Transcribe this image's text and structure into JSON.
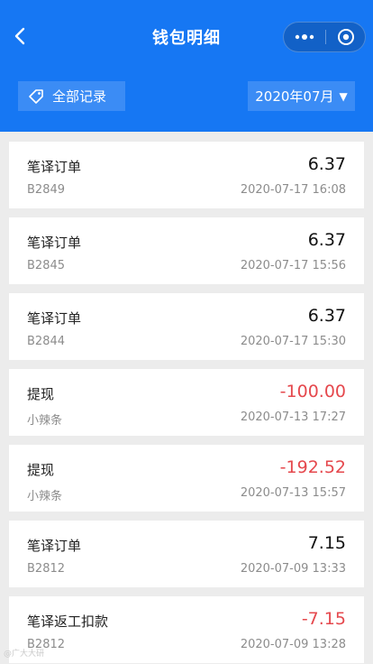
{
  "header": {
    "title": "钱包明细",
    "filter_label": "全部记录",
    "month_label": "2020年07月",
    "month_caret": "▼"
  },
  "colors": {
    "header_bg": "#1677f3",
    "negative": "#e5484d",
    "positive": "#111111"
  },
  "records": [
    {
      "type": "笔译订单",
      "sub": "B2849",
      "amount": "6.37",
      "time": "2020-07-17 16:08",
      "negative": false
    },
    {
      "type": "笔译订单",
      "sub": "B2845",
      "amount": "6.37",
      "time": "2020-07-17 15:56",
      "negative": false
    },
    {
      "type": "笔译订单",
      "sub": "B2844",
      "amount": "6.37",
      "time": "2020-07-17 15:30",
      "negative": false
    },
    {
      "type": "提现",
      "sub": "小辣条",
      "amount": "-100.00",
      "time": "2020-07-13 17:27",
      "negative": true
    },
    {
      "type": "提现",
      "sub": "小辣条",
      "amount": "-192.52",
      "time": "2020-07-13 15:57",
      "negative": true
    },
    {
      "type": "笔译订单",
      "sub": "B2812",
      "amount": "7.15",
      "time": "2020-07-09 13:33",
      "negative": false
    },
    {
      "type": "笔译返工扣款",
      "sub": "B2812",
      "amount": "-7.15",
      "time": "2020-07-09 13:28",
      "negative": true
    }
  ],
  "watermark": "@广大大研"
}
